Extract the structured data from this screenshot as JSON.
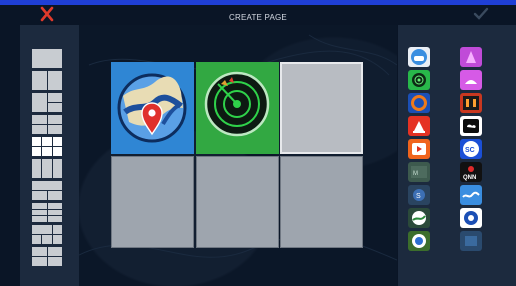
{
  "header": {
    "title": "CREATE PAGE",
    "close_icon": "close-icon",
    "confirm_icon": "checkmark-icon"
  },
  "colors": {
    "accent_bar": "#1f3fd6",
    "close_red": "#e03a2b",
    "background": "#0a1526",
    "panel": "#1c2a3e"
  },
  "layout_picker": {
    "options": [
      {
        "name": "layout-1"
      },
      {
        "name": "layout-2"
      },
      {
        "name": "layout-3"
      },
      {
        "name": "layout-4"
      },
      {
        "name": "layout-5",
        "selected": true
      },
      {
        "name": "layout-6"
      },
      {
        "name": "layout-7"
      },
      {
        "name": "layout-8"
      },
      {
        "name": "layout-9"
      },
      {
        "name": "layout-10"
      }
    ]
  },
  "grid": {
    "cells": [
      {
        "app": "chart-plotter-map"
      },
      {
        "app": "radar"
      },
      {
        "app": "",
        "selected": true
      },
      {
        "app": ""
      },
      {
        "app": ""
      },
      {
        "app": ""
      }
    ]
  },
  "app_tray": {
    "left_column": [
      "weather-app",
      "sonar-app",
      "compass-app",
      "flag-app",
      "video-app",
      "map-tile-app",
      "sirius-app",
      "globe-app",
      "engine-app"
    ],
    "right_column": [
      "color-app",
      "sailboat-app",
      "gauge-app",
      "cloud-app",
      "sc-app",
      "qnn-app",
      "wave-app",
      "location-app",
      "extra-app"
    ]
  }
}
